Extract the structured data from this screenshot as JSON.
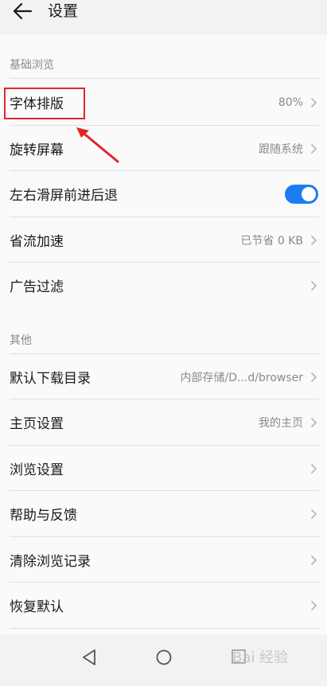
{
  "header": {
    "title": "设置",
    "back_icon": "arrow-left-icon"
  },
  "sections": [
    {
      "label": "基础浏览",
      "items": [
        {
          "label": "字体排版",
          "value": "80%",
          "control": "chevron"
        },
        {
          "label": "旋转屏幕",
          "value": "跟随系统",
          "control": "chevron"
        },
        {
          "label": "左右滑屏前进后退",
          "value": "",
          "control": "toggle",
          "toggle_on": true
        },
        {
          "label": "省流加速",
          "value": "已节省 0 KB",
          "control": "chevron"
        },
        {
          "label": "广告过滤",
          "value": "",
          "control": "chevron"
        }
      ]
    },
    {
      "label": "其他",
      "items": [
        {
          "label": "默认下载目录",
          "value": "内部存储/D...d/browser",
          "control": "chevron"
        },
        {
          "label": "主页设置",
          "value": "我的主页",
          "control": "chevron"
        },
        {
          "label": "浏览设置",
          "value": "",
          "control": "chevron"
        },
        {
          "label": "帮助与反馈",
          "value": "",
          "control": "chevron"
        },
        {
          "label": "清除浏览记录",
          "value": "",
          "control": "chevron"
        },
        {
          "label": "恢复默认",
          "value": "",
          "control": "chevron"
        }
      ]
    }
  ],
  "annotation": {
    "highlight_color": "#e0262a",
    "arrow_color": "#e0262a"
  },
  "navbar": {
    "icons": [
      "back-triangle-icon",
      "home-circle-icon",
      "recents-square-icon"
    ]
  },
  "watermark": {
    "text": "Bai 经验"
  },
  "colors": {
    "accent": "#1a7cf2",
    "background": "#fafafa",
    "secondary_text": "#8a8a8a"
  }
}
